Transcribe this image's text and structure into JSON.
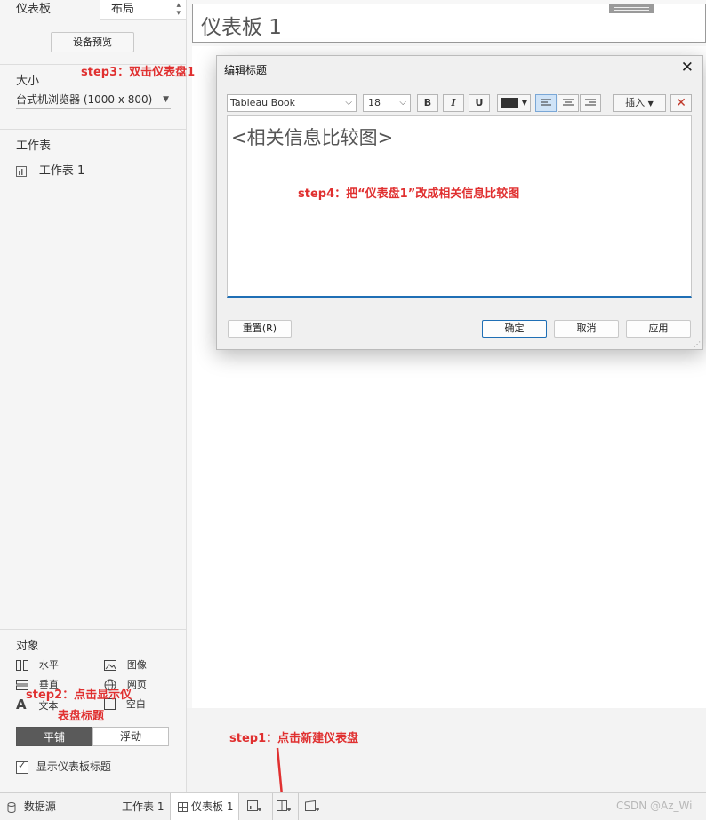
{
  "left_panel": {
    "tab_dashboard": "仪表板",
    "tab_layout": "布局",
    "device_preview_button": "设备预览",
    "size_heading": "大小",
    "size_value": "台式机浏览器 (1000 x 800)",
    "sheets_heading": "工作表",
    "sheet_item": "工作表 1",
    "objects_heading": "对象",
    "objects": {
      "horizontal": "水平",
      "image": "图像",
      "vertical": "垂直",
      "webpage": "网页",
      "text": "文本",
      "blank": "空白"
    },
    "tiled_button": "平铺",
    "floating_button": "浮动",
    "show_title_checkbox": "显示仪表板标题"
  },
  "canvas": {
    "title": "仪表板 1"
  },
  "dialog": {
    "title": "编辑标题",
    "font_name": "Tableau Book",
    "font_size": "18",
    "bold": "B",
    "italic": "I",
    "underline": "U",
    "insert_button": "插入",
    "text": "<相关信息比较图>",
    "reset_button": "重置(R)",
    "ok_button": "确定",
    "cancel_button": "取消",
    "apply_button": "应用"
  },
  "annotations": {
    "step3": "step3：双击仪表盘1",
    "step4": "step4：把“仪表盘1”改成相关信息比较图",
    "step2_line1": "step2：点击显示仪",
    "step2_line2": "表盘标题",
    "step1": "step1：点击新建仪表盘"
  },
  "tabbar": {
    "datasource": "数据源",
    "sheet1": "工作表 1",
    "dashboard1": "仪表板 1",
    "watermark": "CSDN @Az_Wi"
  },
  "colors": {
    "annotation": "#e03030",
    "accent": "#1f6fb5"
  }
}
